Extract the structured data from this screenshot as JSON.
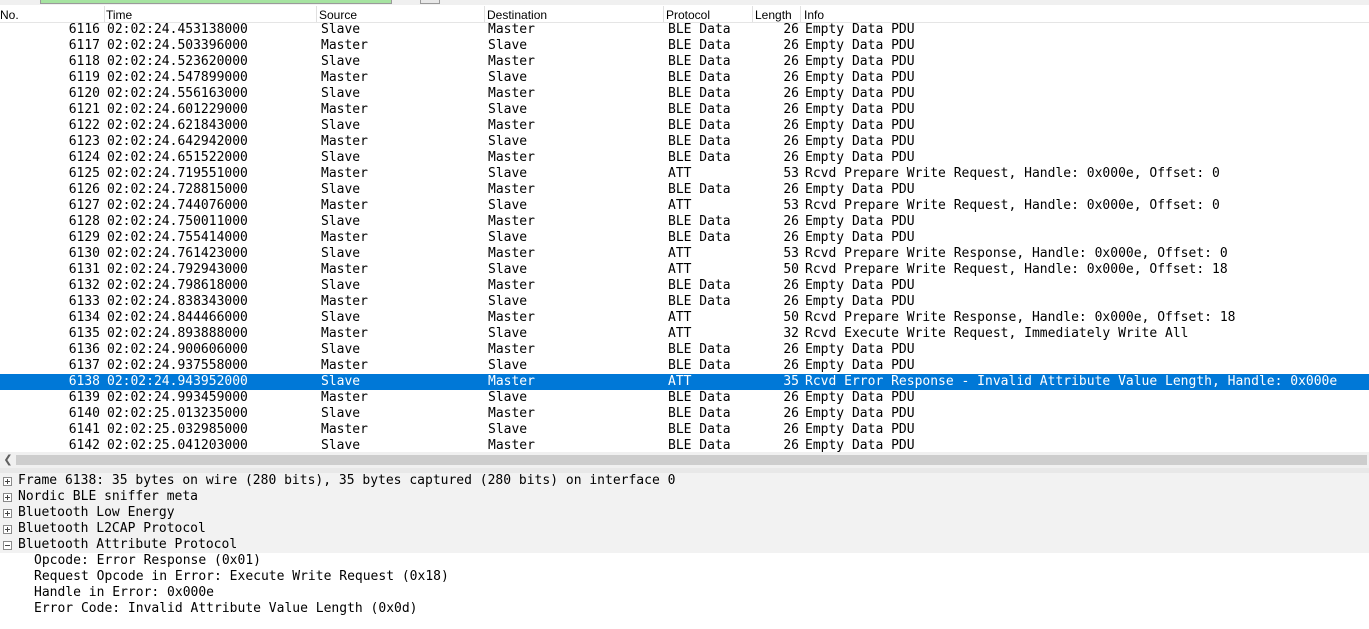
{
  "columns": {
    "no": "No.",
    "time": "Time",
    "source": "Source",
    "destination": "Destination",
    "protocol": "Protocol",
    "length": "Length",
    "info": "Info"
  },
  "packets": [
    {
      "no": "6116",
      "time": "02:02:24.453138000",
      "source": "Slave",
      "destination": "Master",
      "protocol": "BLE Data",
      "length": "26",
      "info": "Empty Data PDU"
    },
    {
      "no": "6117",
      "time": "02:02:24.503396000",
      "source": "Master",
      "destination": "Slave",
      "protocol": "BLE Data",
      "length": "26",
      "info": "Empty Data PDU"
    },
    {
      "no": "6118",
      "time": "02:02:24.523620000",
      "source": "Slave",
      "destination": "Master",
      "protocol": "BLE Data",
      "length": "26",
      "info": "Empty Data PDU"
    },
    {
      "no": "6119",
      "time": "02:02:24.547899000",
      "source": "Master",
      "destination": "Slave",
      "protocol": "BLE Data",
      "length": "26",
      "info": "Empty Data PDU"
    },
    {
      "no": "6120",
      "time": "02:02:24.556163000",
      "source": "Slave",
      "destination": "Master",
      "protocol": "BLE Data",
      "length": "26",
      "info": "Empty Data PDU"
    },
    {
      "no": "6121",
      "time": "02:02:24.601229000",
      "source": "Master",
      "destination": "Slave",
      "protocol": "BLE Data",
      "length": "26",
      "info": "Empty Data PDU"
    },
    {
      "no": "6122",
      "time": "02:02:24.621843000",
      "source": "Slave",
      "destination": "Master",
      "protocol": "BLE Data",
      "length": "26",
      "info": "Empty Data PDU"
    },
    {
      "no": "6123",
      "time": "02:02:24.642942000",
      "source": "Master",
      "destination": "Slave",
      "protocol": "BLE Data",
      "length": "26",
      "info": "Empty Data PDU"
    },
    {
      "no": "6124",
      "time": "02:02:24.651522000",
      "source": "Slave",
      "destination": "Master",
      "protocol": "BLE Data",
      "length": "26",
      "info": "Empty Data PDU"
    },
    {
      "no": "6125",
      "time": "02:02:24.719551000",
      "source": "Master",
      "destination": "Slave",
      "protocol": "ATT",
      "length": "53",
      "info": "Rcvd Prepare Write Request, Handle: 0x000e, Offset: 0"
    },
    {
      "no": "6126",
      "time": "02:02:24.728815000",
      "source": "Slave",
      "destination": "Master",
      "protocol": "BLE Data",
      "length": "26",
      "info": "Empty Data PDU"
    },
    {
      "no": "6127",
      "time": "02:02:24.744076000",
      "source": "Master",
      "destination": "Slave",
      "protocol": "ATT",
      "length": "53",
      "info": "Rcvd Prepare Write Request, Handle: 0x000e, Offset: 0"
    },
    {
      "no": "6128",
      "time": "02:02:24.750011000",
      "source": "Slave",
      "destination": "Master",
      "protocol": "BLE Data",
      "length": "26",
      "info": "Empty Data PDU"
    },
    {
      "no": "6129",
      "time": "02:02:24.755414000",
      "source": "Master",
      "destination": "Slave",
      "protocol": "BLE Data",
      "length": "26",
      "info": "Empty Data PDU"
    },
    {
      "no": "6130",
      "time": "02:02:24.761423000",
      "source": "Slave",
      "destination": "Master",
      "protocol": "ATT",
      "length": "53",
      "info": "Rcvd Prepare Write Response, Handle: 0x000e, Offset: 0"
    },
    {
      "no": "6131",
      "time": "02:02:24.792943000",
      "source": "Master",
      "destination": "Slave",
      "protocol": "ATT",
      "length": "50",
      "info": "Rcvd Prepare Write Request, Handle: 0x000e, Offset: 18"
    },
    {
      "no": "6132",
      "time": "02:02:24.798618000",
      "source": "Slave",
      "destination": "Master",
      "protocol": "BLE Data",
      "length": "26",
      "info": "Empty Data PDU"
    },
    {
      "no": "6133",
      "time": "02:02:24.838343000",
      "source": "Master",
      "destination": "Slave",
      "protocol": "BLE Data",
      "length": "26",
      "info": "Empty Data PDU"
    },
    {
      "no": "6134",
      "time": "02:02:24.844466000",
      "source": "Slave",
      "destination": "Master",
      "protocol": "ATT",
      "length": "50",
      "info": "Rcvd Prepare Write Response, Handle: 0x000e, Offset: 18"
    },
    {
      "no": "6135",
      "time": "02:02:24.893888000",
      "source": "Master",
      "destination": "Slave",
      "protocol": "ATT",
      "length": "32",
      "info": "Rcvd Execute Write Request, Immediately Write All"
    },
    {
      "no": "6136",
      "time": "02:02:24.900606000",
      "source": "Slave",
      "destination": "Master",
      "protocol": "BLE Data",
      "length": "26",
      "info": "Empty Data PDU"
    },
    {
      "no": "6137",
      "time": "02:02:24.937558000",
      "source": "Master",
      "destination": "Slave",
      "protocol": "BLE Data",
      "length": "26",
      "info": "Empty Data PDU"
    },
    {
      "no": "6138",
      "time": "02:02:24.943952000",
      "source": "Slave",
      "destination": "Master",
      "protocol": "ATT",
      "length": "35",
      "info": "Rcvd Error Response - Invalid Attribute Value Length, Handle: 0x000e",
      "selected": true
    },
    {
      "no": "6139",
      "time": "02:02:24.993459000",
      "source": "Master",
      "destination": "Slave",
      "protocol": "BLE Data",
      "length": "26",
      "info": "Empty Data PDU"
    },
    {
      "no": "6140",
      "time": "02:02:25.013235000",
      "source": "Slave",
      "destination": "Master",
      "protocol": "BLE Data",
      "length": "26",
      "info": "Empty Data PDU"
    },
    {
      "no": "6141",
      "time": "02:02:25.032985000",
      "source": "Master",
      "destination": "Slave",
      "protocol": "BLE Data",
      "length": "26",
      "info": "Empty Data PDU"
    },
    {
      "no": "6142",
      "time": "02:02:25.041203000",
      "source": "Slave",
      "destination": "Master",
      "protocol": "BLE Data",
      "length": "26",
      "info": "Empty Data PDU"
    }
  ],
  "details": [
    {
      "label": "Frame 6138: 35 bytes on wire (280 bits), 35 bytes captured (280 bits) on interface 0",
      "expander": "plus"
    },
    {
      "label": "Nordic BLE sniffer meta",
      "expander": "plus"
    },
    {
      "label": "Bluetooth Low Energy",
      "expander": "plus"
    },
    {
      "label": "Bluetooth L2CAP Protocol",
      "expander": "plus"
    },
    {
      "label": "Bluetooth Attribute Protocol",
      "expander": "minus"
    },
    {
      "label": "Opcode: Error Response (0x01)",
      "expander": "none"
    },
    {
      "label": "Request Opcode in Error: Execute Write Request (0x18)",
      "expander": "none"
    },
    {
      "label": "Handle in Error: 0x000e",
      "expander": "none"
    },
    {
      "label": "Error Code: Invalid Attribute Value Length (0x0d)",
      "expander": "none"
    }
  ],
  "scroll_left_icon": "chevron-left-icon",
  "colors": {
    "selection": "#0078d7",
    "tree_header_bg": "#f2f2f2",
    "filter_valid": "#a6e3a1"
  }
}
